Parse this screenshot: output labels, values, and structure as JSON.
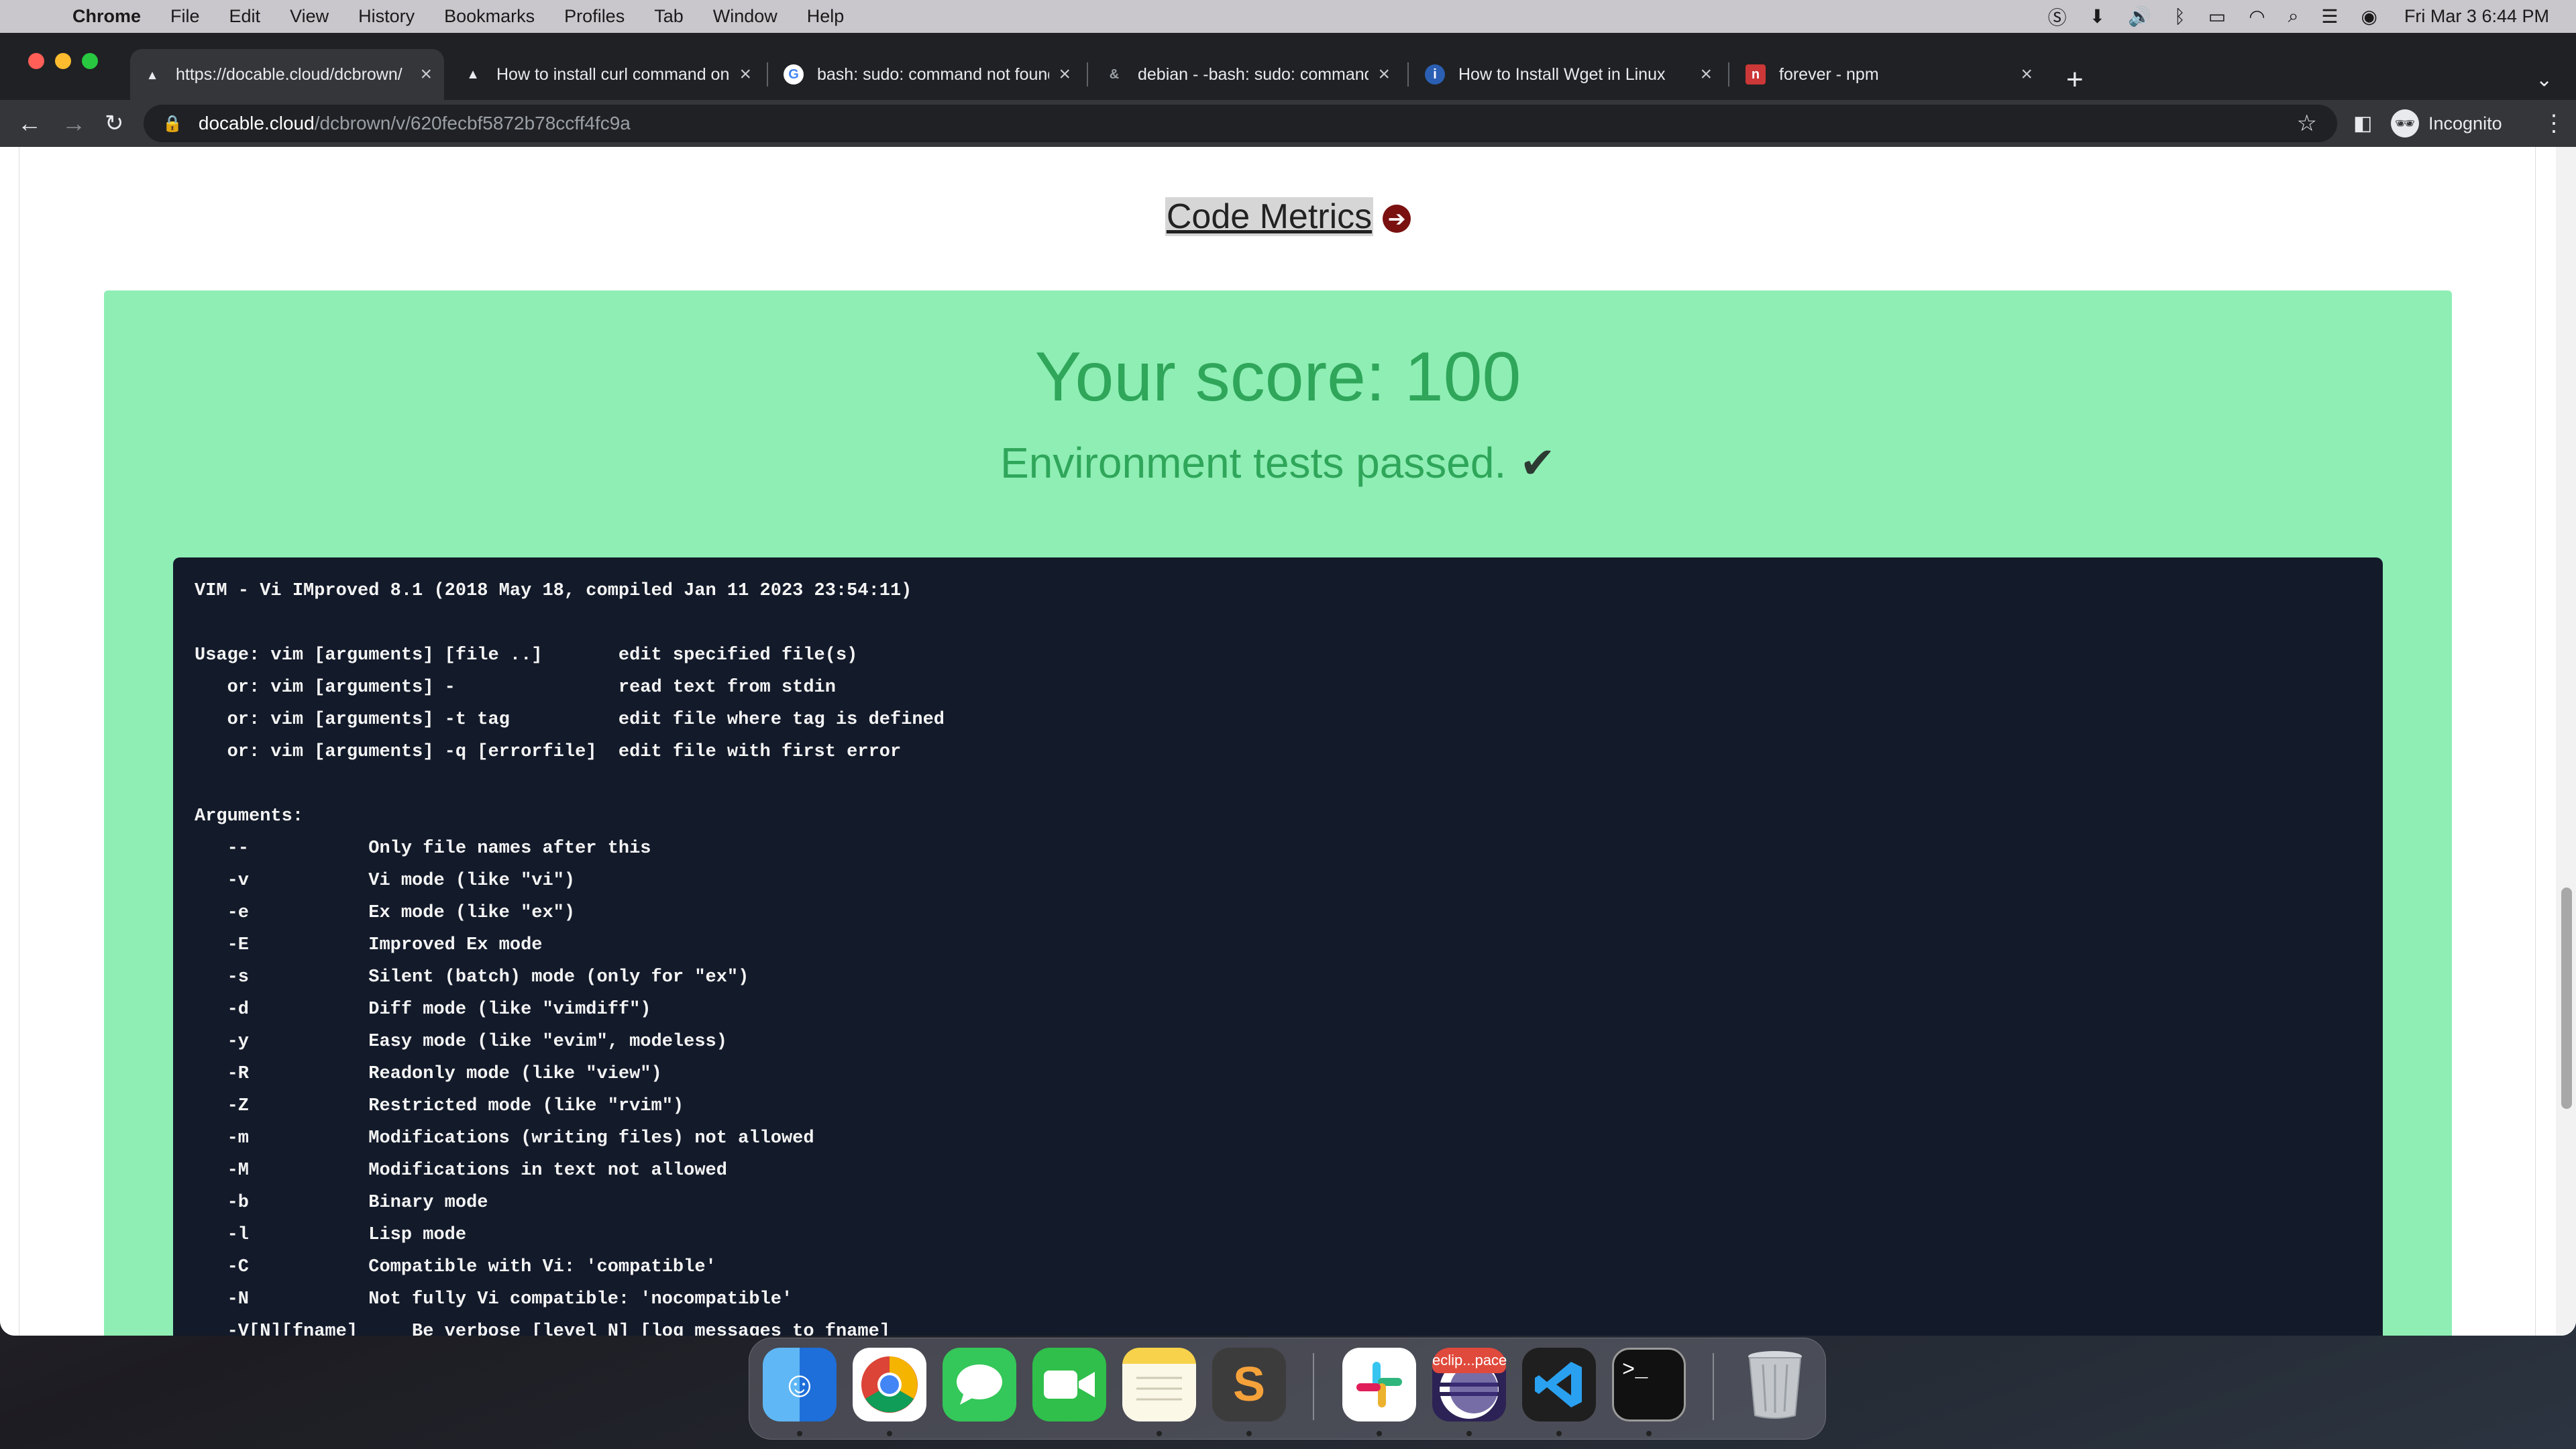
{
  "menubar": {
    "app_name": "Chrome",
    "menus": [
      "File",
      "Edit",
      "View",
      "History",
      "Bookmarks",
      "Profiles",
      "Tab",
      "Window",
      "Help"
    ],
    "clock": "Fri Mar 3  6:44 PM",
    "status_icons": [
      "skype-icon",
      "download-icon",
      "volume-icon",
      "bluetooth-icon",
      "battery-icon",
      "wifi-icon",
      "spotlight-icon",
      "control-center-icon",
      "siri-icon"
    ]
  },
  "tabs": [
    {
      "title": "https://docable.cloud/dcbrown/",
      "favicon": "docable-icon",
      "active": true
    },
    {
      "title": "How to install curl command on",
      "favicon": "article-icon",
      "active": false
    },
    {
      "title": "bash: sudo: command not found",
      "favicon": "google-icon",
      "active": false
    },
    {
      "title": "debian - -bash: sudo: command",
      "favicon": "stackexchange-icon",
      "active": false
    },
    {
      "title": "How to Install Wget in Linux",
      "favicon": "article-icon",
      "active": false
    },
    {
      "title": "forever - npm",
      "favicon": "npm-icon",
      "active": false
    }
  ],
  "toolbar": {
    "url_host": "docable.cloud",
    "url_path": "/dcbrown/v/620fecbf5872b78ccff4fc9a",
    "profile_label": "Incognito"
  },
  "page": {
    "code_metrics_label": "Code Metrics",
    "score_text": "Your score: 100",
    "env_text": "Environment tests passed.",
    "check_glyph": "✔",
    "panel_color": "#8eeeb4",
    "score_color": "#2fa65a",
    "terminal_output": "VIM - Vi IMproved 8.1 (2018 May 18, compiled Jan 11 2023 23:54:11)\n\nUsage: vim [arguments] [file ..]       edit specified file(s)\n   or: vim [arguments] -               read text from stdin\n   or: vim [arguments] -t tag          edit file where tag is defined\n   or: vim [arguments] -q [errorfile]  edit file with first error\n\nArguments:\n   --           Only file names after this\n   -v           Vi mode (like \"vi\")\n   -e           Ex mode (like \"ex\")\n   -E           Improved Ex mode\n   -s           Silent (batch) mode (only for \"ex\")\n   -d           Diff mode (like \"vimdiff\")\n   -y           Easy mode (like \"evim\", modeless)\n   -R           Readonly mode (like \"view\")\n   -Z           Restricted mode (like \"rvim\")\n   -m           Modifications (writing files) not allowed\n   -M           Modifications in text not allowed\n   -b           Binary mode\n   -l           Lisp mode\n   -C           Compatible with Vi: 'compatible'\n   -N           Not fully Vi compatible: 'nocompatible'\n   -V[N][fname]     Be verbose [level N] [log messages to fname]\n   -D           Debugging mode"
  },
  "dock": {
    "apps": [
      {
        "name": "finder",
        "color": "#3a8ee6",
        "glyph": "☺",
        "running": true
      },
      {
        "name": "chrome",
        "color": "#ffffff",
        "glyph": "◉",
        "running": true
      },
      {
        "name": "messages",
        "color": "#34c759",
        "glyph": "💬",
        "running": false
      },
      {
        "name": "facetime",
        "color": "#2fbf4a",
        "glyph": "▶",
        "running": false
      },
      {
        "name": "notes",
        "color": "#f7f2d0",
        "glyph": "☰",
        "running": true
      },
      {
        "name": "sublime-text",
        "color": "#3c3c3c",
        "glyph": "S",
        "running": true
      },
      {
        "name": "slack",
        "color": "#ffffff",
        "glyph": "#",
        "running": true
      },
      {
        "name": "eclipse",
        "color": "#2c2255",
        "glyph": "◐",
        "running": true,
        "badge": "eclip...pace"
      },
      {
        "name": "vscode",
        "color": "#1f1f1f",
        "glyph": "⟨⟩",
        "running": true
      },
      {
        "name": "terminal",
        "color": "#111111",
        "glyph": ">_",
        "running": true
      },
      {
        "name": "trash",
        "color": "#b8bcc2",
        "glyph": "🗑",
        "running": false
      }
    ]
  }
}
